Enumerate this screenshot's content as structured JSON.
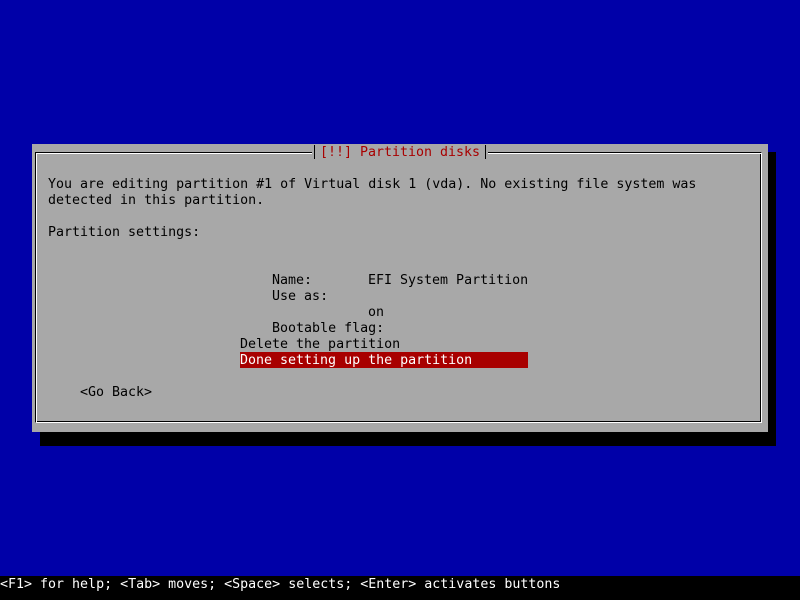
{
  "dialog": {
    "title": "[!!] Partition disks",
    "description_line1": "You are editing partition #1 of Virtual disk 1 (vda). No existing file system was",
    "description_line2": "detected in this partition.",
    "settings_heading": "Partition settings:",
    "fields": {
      "name_label": "Name:",
      "name_value": "",
      "use_as_label": "Use as:",
      "use_as_value": "EFI System Partition",
      "bootable_label": "Bootable flag:",
      "bootable_value": "on"
    },
    "actions": {
      "delete": "Delete the partition",
      "done": "Done setting up the partition"
    },
    "go_back": "<Go Back>"
  },
  "statusbar": {
    "help": "<F1> for help; <Tab> moves; <Space> selects; <Enter> activates buttons"
  },
  "colors": {
    "background": "#0000a8",
    "dialog": "#a8a8a8",
    "title": "#a80000",
    "selection": "#a80000"
  }
}
